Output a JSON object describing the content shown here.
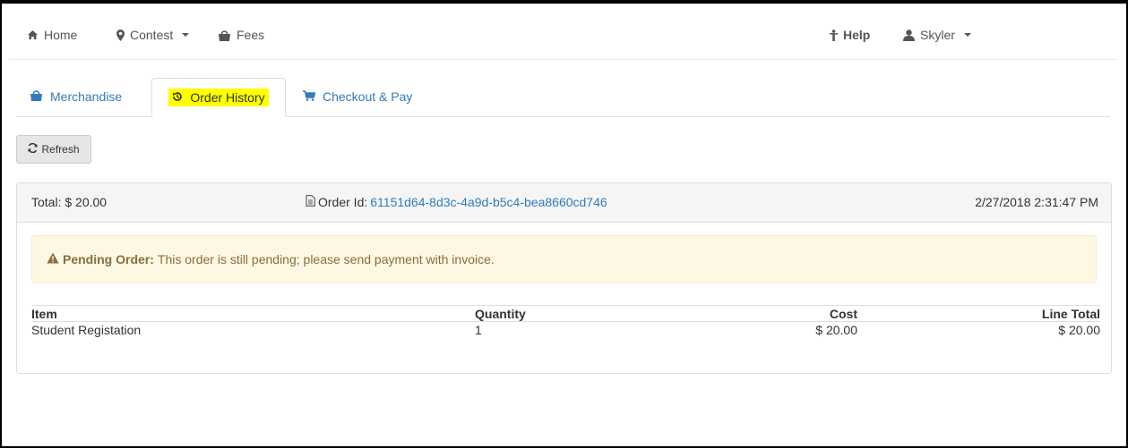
{
  "navbar": {
    "home": "Home",
    "contest": "Contest",
    "fees": "Fees",
    "help": "Help",
    "user": "Skyler"
  },
  "tabs": [
    {
      "label": "Merchandise",
      "icon": "shopping-bag-icon"
    },
    {
      "label": "Order History",
      "icon": "history-icon",
      "active": true
    },
    {
      "label": "Checkout & Pay",
      "icon": "cart-icon"
    }
  ],
  "refresh_label": "Refresh",
  "order": {
    "total": "Total: $ 20.00",
    "order_id_label": "Order Id:",
    "order_id": "61151d64-8d3c-4a9d-b5c4-bea8660cd746",
    "date": "2/27/2018 2:31:47 PM"
  },
  "alert": {
    "title": "Pending Order:",
    "message": "This order is still pending; please send payment with invoice."
  },
  "table": {
    "headers": [
      "Item",
      "Quantity",
      "Cost",
      "Line Total"
    ],
    "rows": [
      [
        "Student Registation",
        "1",
        "$ 20.00",
        "$ 20.00"
      ]
    ]
  },
  "colors": {
    "link": "#337ab7",
    "highlight": "#ffff00",
    "alert_bg": "#fcf8e3",
    "alert_text": "#8a6d3b"
  }
}
